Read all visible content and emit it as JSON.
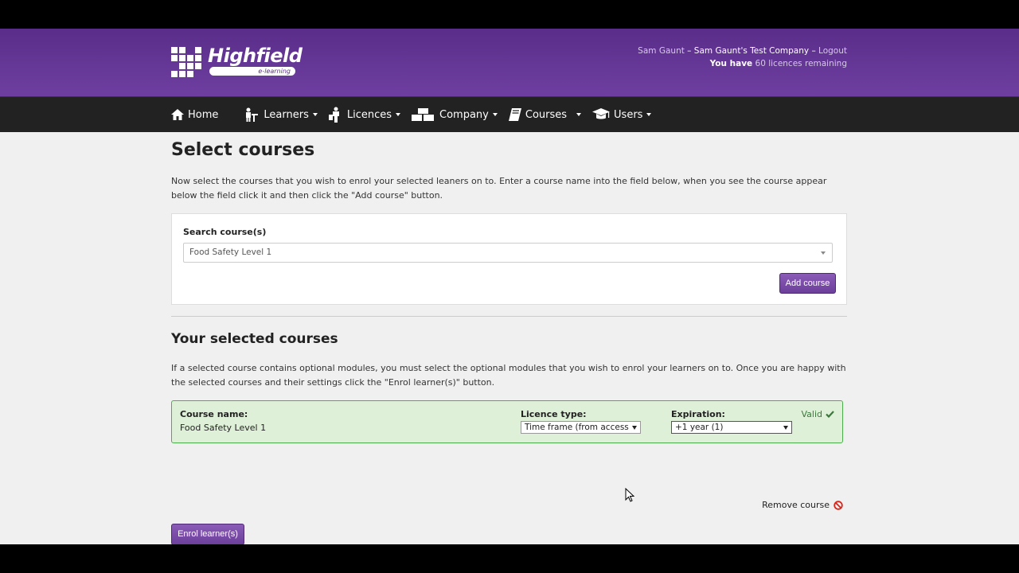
{
  "header": {
    "logo_text": "Highfield",
    "logo_sub": "e-learning",
    "account": {
      "user": "Sam Gaunt",
      "sep1": " – ",
      "company": "Sam Gaunt's Test Company",
      "sep2": " – ",
      "logout": "Logout",
      "licences_prefix": "You have",
      "licences_count": "60 licences remaining"
    }
  },
  "nav": {
    "items": [
      {
        "label": "Home",
        "icon": "home-icon"
      },
      {
        "label": "Learners",
        "icon": "learners-icon"
      },
      {
        "label": "Licences",
        "icon": "licences-icon"
      },
      {
        "label": "Company",
        "icon": "company-icon"
      },
      {
        "label": "Courses",
        "icon": "courses-icon"
      },
      {
        "label": "Users",
        "icon": "users-icon"
      }
    ]
  },
  "main": {
    "title": "Select courses",
    "description": "Now select the courses that you wish to enrol your selected leaners on to. Enter a course name into the field below, when you see the course appear below the field click it and then click the \"Add course\" button.",
    "search_label": "Search course(s)",
    "search_value": "Food Safety Level 1",
    "add_button": "Add course",
    "selected_title": "Your selected courses",
    "selected_description": "If a selected course contains optional modules, you must select the optional modules that you wish to enrol your learners on to. Once you are happy with the selected courses and their settings click the \"Enrol learner(s)\" button.",
    "course": {
      "name_label": "Course name:",
      "name_value": "Food Safety Level 1",
      "licence_label": "Licence type:",
      "licence_value": "Time frame (from access",
      "expiration_label": "Expiration:",
      "expiration_value": "+1 year (1)",
      "status": "Valid"
    },
    "remove_label": "Remove course",
    "enrol_button": "Enrol learner(s)"
  },
  "colors": {
    "header_purple": "#6e3fa0",
    "nav_dark": "#222222",
    "valid_green": "#3c763d",
    "valid_bg": "#dff0d8"
  }
}
